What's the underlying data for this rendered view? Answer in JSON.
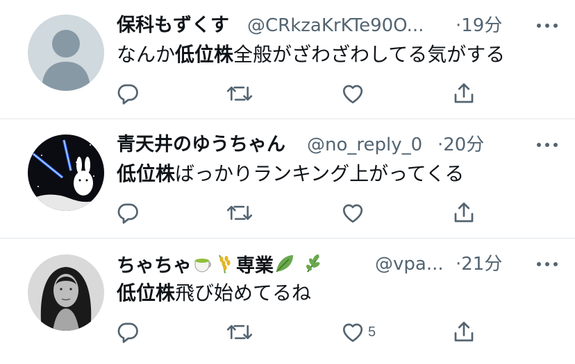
{
  "tweets": [
    {
      "name": "保科もずくす",
      "handle": "@CRkzaKrKTe90O...",
      "time": "·19分",
      "text_pre": "なんか",
      "text_bold": "低位株",
      "text_post": "全般がざわざわしてる気がする",
      "like_count": ""
    },
    {
      "name": "青天井のゆうちゃん",
      "handle": "@no_reply_0",
      "time": "·20分",
      "text_pre": "",
      "text_bold": "低位株",
      "text_post": "ばっかりランキング上がってくる",
      "like_count": ""
    },
    {
      "name_pre": "ちゃちゃ",
      "name_mid": "専業",
      "handle": "@vpa...",
      "time": "·21分",
      "text_pre": "",
      "text_bold": "低位株",
      "text_post": "飛び始めてるね",
      "like_count": "5"
    }
  ],
  "icons": {
    "reply": "reply-icon",
    "retweet": "retweet-icon",
    "like": "heart-icon",
    "share": "share-icon",
    "more": "more-dots-icon",
    "emoji_1": "tea-emoji-icon",
    "emoji_2": "rice-emoji-icon",
    "emoji_3": "leaf-emoji-icon",
    "emoji_4": "herb-emoji-icon"
  },
  "colors": {
    "name": "#0f1419",
    "secondary": "#536471",
    "divider": "#e1e6ea"
  }
}
